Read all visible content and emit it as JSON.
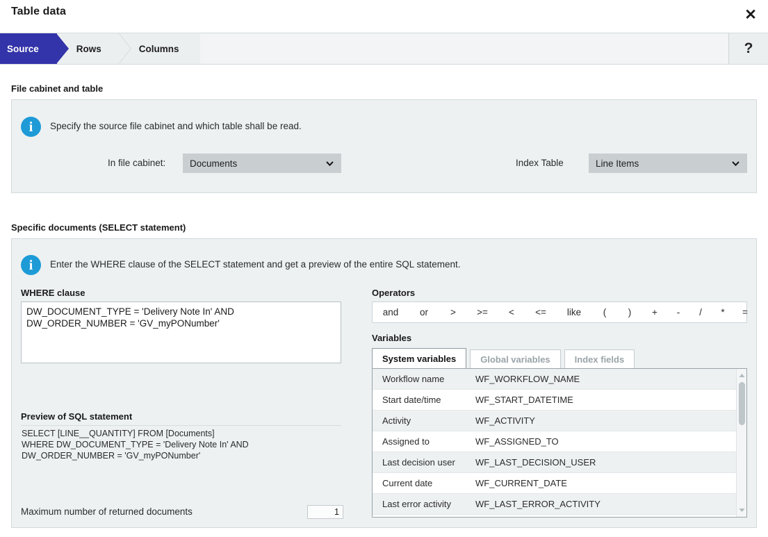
{
  "dialog": {
    "title": "Table data",
    "close_icon": "close-icon",
    "help_label": "?"
  },
  "tabs": [
    {
      "label": "Source",
      "active": true
    },
    {
      "label": "Rows",
      "active": false
    },
    {
      "label": "Columns",
      "active": false
    }
  ],
  "file_cabinet_section": {
    "heading": "File cabinet and table",
    "info_icon": "info-icon",
    "info_text": "Specify the source file cabinet and which table shall be read.",
    "file_cabinet_label": "In file cabinet:",
    "file_cabinet_value": "Documents",
    "index_table_label": "Index Table",
    "index_table_value": "Line Items"
  },
  "specific_documents_section": {
    "heading": "Specific documents (SELECT statement)",
    "info_icon": "info-icon",
    "info_text": "Enter the WHERE clause of the SELECT statement and get a preview of the entire SQL statement.",
    "where_label": "WHERE clause",
    "where_value": "DW_DOCUMENT_TYPE = 'Delivery Note In' AND DW_ORDER_NUMBER = 'GV_myPONumber'",
    "preview_label": "Preview of SQL statement",
    "preview_value": "SELECT [LINE__QUANTITY] FROM [Documents]\nWHERE DW_DOCUMENT_TYPE = 'Delivery Note In' AND\nDW_ORDER_NUMBER = 'GV_myPONumber'",
    "max_docs_label": "Maximum number of returned documents",
    "max_docs_value": "1",
    "operators_label": "Operators",
    "operators": [
      "and",
      "or",
      ">",
      ">=",
      "<",
      "<=",
      "like",
      "(",
      ")",
      "+",
      "-",
      "/",
      "*",
      "="
    ],
    "variables_label": "Variables",
    "variable_tabs": [
      {
        "label": "System variables",
        "active": true
      },
      {
        "label": "Global variables",
        "active": false
      },
      {
        "label": "Index fields",
        "active": false
      }
    ],
    "variables": [
      {
        "name": "Workflow name",
        "code": "WF_WORKFLOW_NAME"
      },
      {
        "name": "Start date/time",
        "code": "WF_START_DATETIME"
      },
      {
        "name": "Activity",
        "code": "WF_ACTIVITY"
      },
      {
        "name": "Assigned to",
        "code": "WF_ASSIGNED_TO"
      },
      {
        "name": "Last decision user",
        "code": "WF_LAST_DECISION_USER"
      },
      {
        "name": "Current date",
        "code": "WF_CURRENT_DATE"
      },
      {
        "name": "Last error activity",
        "code": "WF_LAST_ERROR_ACTIVITY"
      }
    ]
  },
  "colors": {
    "accent_blue": "#3333aa",
    "info_blue": "#1e9bd7",
    "panel_bg": "#edf1f2",
    "select_bg": "#c9ced1"
  }
}
